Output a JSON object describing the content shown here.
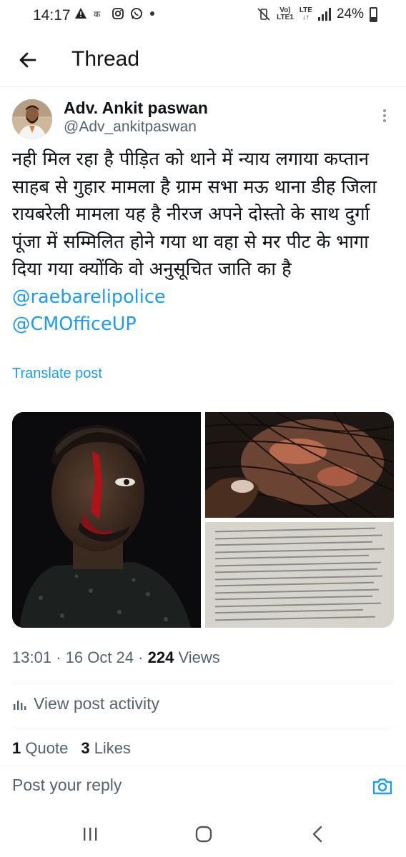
{
  "status_bar": {
    "time": "14:17",
    "battery": "24%",
    "battery_level": 0.24,
    "network": "LTE",
    "left_icons": [
      "warning-icon",
      "app-notification-icon",
      "instagram-icon",
      "whatsapp-icon",
      "dot-icon"
    ],
    "right_icons": [
      "mute-vibrate-icon",
      "volte-icon",
      "lte-icon",
      "signal-icon",
      "battery-icon"
    ]
  },
  "header": {
    "title": "Thread"
  },
  "post": {
    "author_name": "Adv. Ankit paswan",
    "author_handle": "@Adv_ankitpaswan",
    "text": "नही मिल रहा है पीड़ित को थाने में न्याय लगाया कप्तान साहब से गुहार मामला है ग्राम सभा मऊ थाना डीह जिला रायबरेली मामला यह है नीरज अपने दोस्तो के साथ दुर्गा पूंजा में सम्मिलित होने गया था वहा से मर पीट के भागा दिया गया क्योंकि वो अनुसूचित जाति का है",
    "mentions": [
      "@raebarelipolice",
      "@CMOfficeUP"
    ],
    "translate_label": "Translate post",
    "time": "13:01",
    "date": "16 Oct 24",
    "views_count": "224",
    "views_label": "Views",
    "separator": "·",
    "activity_label": "View post activity",
    "quotes_count": "1",
    "quotes_label": "Quote",
    "likes_count": "3",
    "likes_label": "Likes"
  },
  "reply": {
    "placeholder": "Post your reply"
  },
  "colors": {
    "accent": "#1d9bf0",
    "text": "#0f1419",
    "secondary": "#536471",
    "divider": "#eff3f4"
  }
}
